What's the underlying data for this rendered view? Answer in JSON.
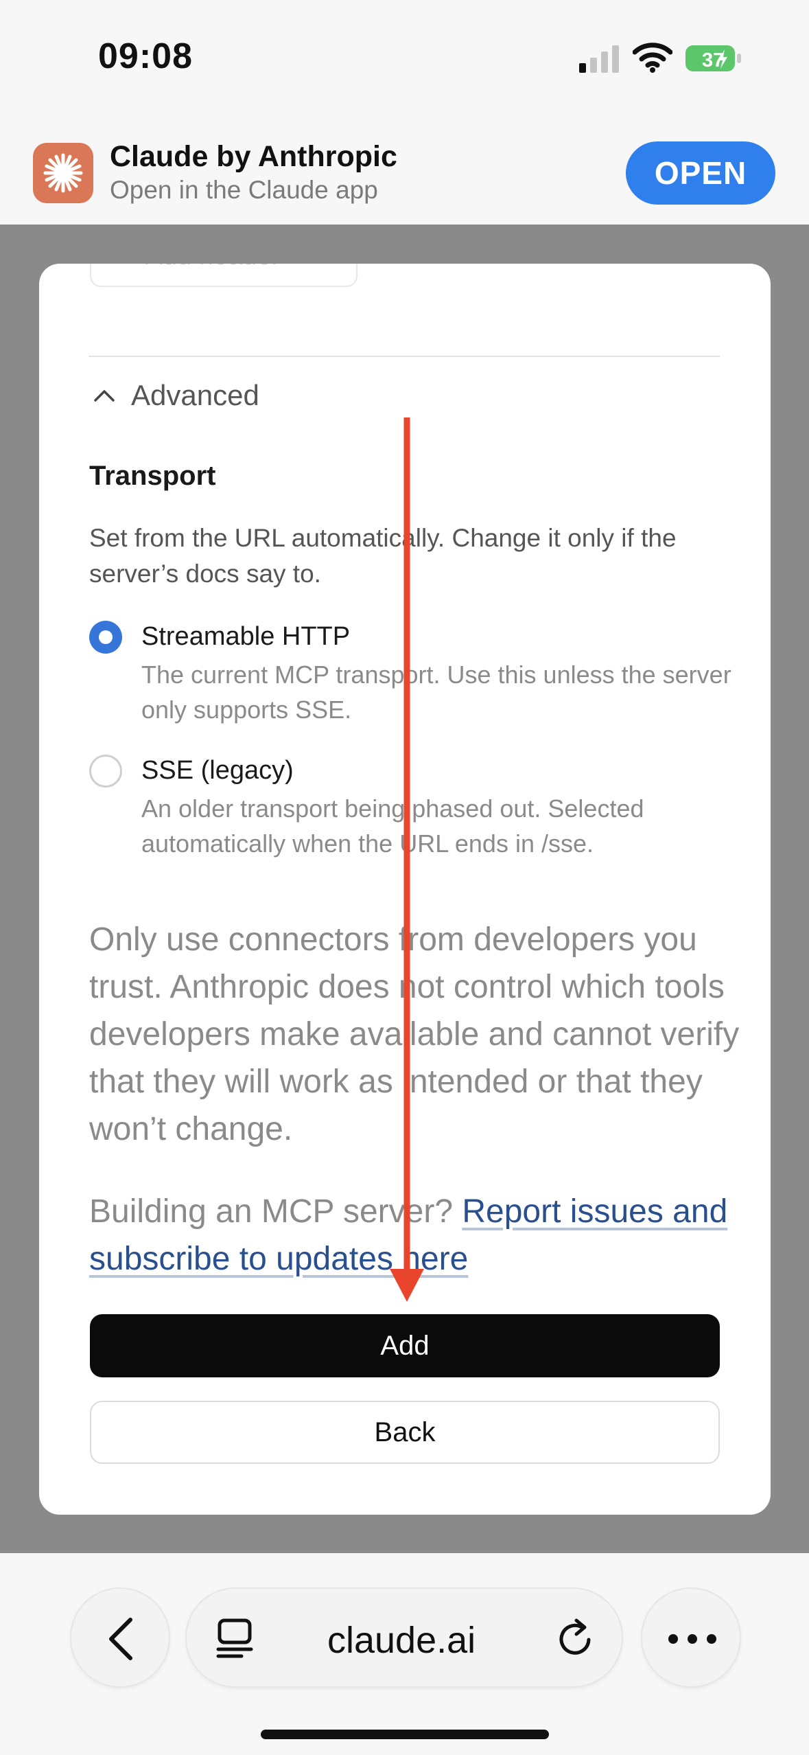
{
  "status_bar": {
    "time": "09:08",
    "battery": "37"
  },
  "banner": {
    "app_name": "Claude by Anthropic",
    "subtitle": "Open in the Claude app",
    "open_label": "OPEN"
  },
  "modal": {
    "add_header_label": "+ Add header",
    "advanced_label": "Advanced",
    "transport": {
      "title": "Transport",
      "description": "Set from the URL automatically. Change it only if the server’s docs say to.",
      "options": [
        {
          "label": "Streamable HTTP",
          "description": "The current MCP transport. Use this unless the server only supports SSE.",
          "selected": true
        },
        {
          "label": "SSE (legacy)",
          "description": "An older transport being phased out. Selected automatically when the URL ends in /sse.",
          "selected": false
        }
      ]
    },
    "warning": "Only use connectors from developers you trust. Anthropic does not control which tools developers make available and cannot verify that they will work as intended or that they won’t change.",
    "building_prefix": "Building an MCP server? ",
    "building_link": "Report issues and subscribe to updates here",
    "add_label": "Add",
    "back_label": "Back"
  },
  "browser": {
    "url": "claude.ai"
  },
  "colors": {
    "accent": "#2f80ed",
    "radio": "#3576d8",
    "annotation_arrow": "#e8452c",
    "brand": "#d97757"
  }
}
